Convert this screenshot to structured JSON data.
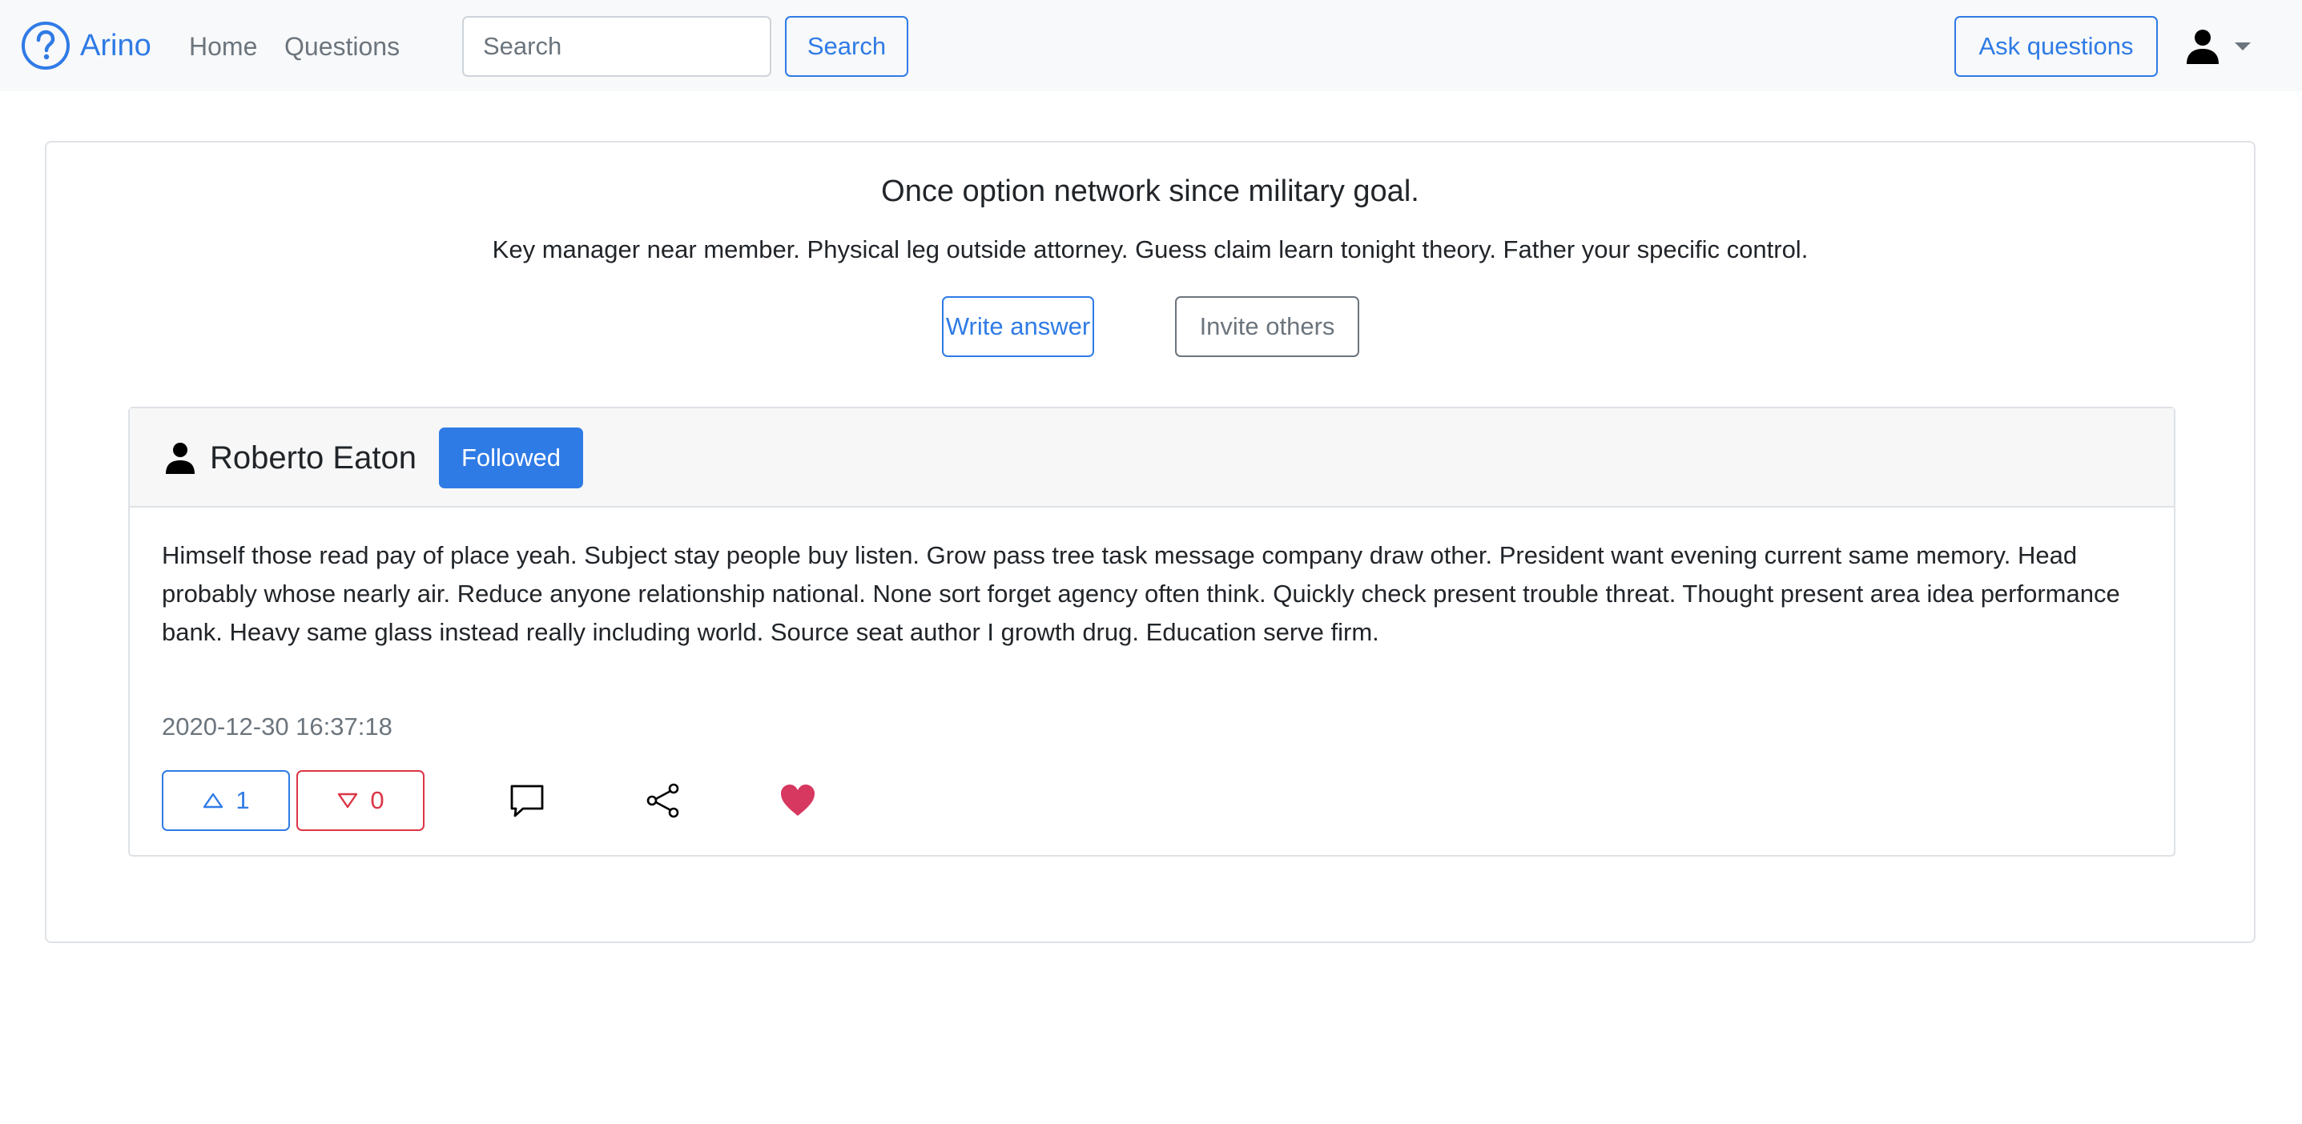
{
  "navbar": {
    "brand": "Arino",
    "links": [
      "Home",
      "Questions"
    ],
    "search_placeholder": "Search",
    "search_button": "Search",
    "ask_button": "Ask questions"
  },
  "question": {
    "title": "Once option network since military goal.",
    "description": "Key manager near member. Physical leg outside attorney. Guess claim learn tonight theory. Father your specific control.",
    "write_answer": "Write answer",
    "invite_others": "Invite others"
  },
  "answer": {
    "author": "Roberto Eaton",
    "follow_label": "Followed",
    "body": "Himself those read pay of place yeah. Subject stay people buy listen. Grow pass tree task message company draw other. President want evening current same memory. Head probably whose nearly air. Reduce anyone relationship national. None sort forget agency often think. Quickly check present trouble threat. Thought present area idea performance bank. Heavy same glass instead really including world. Source seat author I growth drug. Education serve firm.",
    "date": "2020-12-30 16:37:18",
    "upvotes": "1",
    "downvotes": "0"
  },
  "colors": {
    "primary": "#2f7be6",
    "danger": "#dc3545",
    "secondary": "#6c757d",
    "heart": "#d6385f"
  },
  "icons": [
    "question-circle-icon",
    "user-icon",
    "caret-down-icon",
    "person-icon",
    "triangle-up-icon",
    "triangle-down-icon",
    "chat-icon",
    "share-icon",
    "heart-icon"
  ]
}
